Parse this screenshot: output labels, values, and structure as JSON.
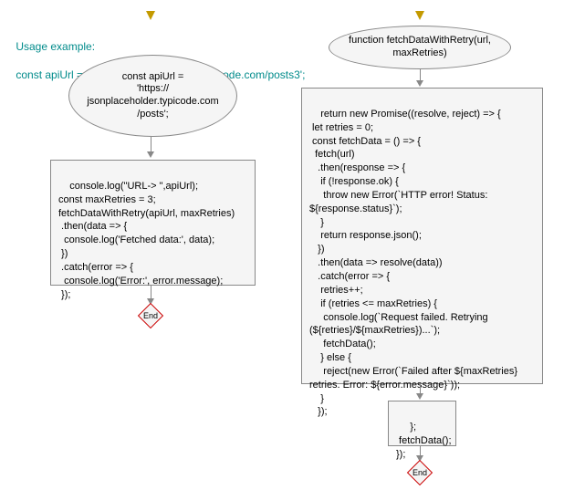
{
  "usage": {
    "line1": "Usage example:",
    "line2": "const apiUrl = 'https://jsonplaceholder.typicode.com/posts3';"
  },
  "left": {
    "ellipse_text": "const apiUrl =\n'https://\njsonplaceholder.typicode.com\n/posts';",
    "rect_text": "console.log(\"URL-> \",apiUrl);\nconst maxRetries = 3;\nfetchDataWithRetry(apiUrl, maxRetries)\n .then(data => {\n  console.log('Fetched data:', data);\n })\n .catch(error => {\n  console.log('Error:', error.message);\n });",
    "end_label": "End"
  },
  "right": {
    "ellipse_text": "function fetchDataWithRetry(url,\nmaxRetries)",
    "rect1_text": "return new Promise((resolve, reject) => {\n let retries = 0;\n const fetchData = () => {\n  fetch(url)\n   .then(response => {\n    if (!response.ok) {\n     throw new Error(`HTTP error! Status:\n${response.status}`);\n    }\n    return response.json();\n   })\n   .then(data => resolve(data))\n   .catch(error => {\n    retries++;\n    if (retries <= maxRetries) {\n     console.log(`Request failed. Retrying\n(${retries}/${maxRetries})...`);\n     fetchData();\n    } else {\n     reject(new Error(`Failed after ${maxRetries}\nretries. Error: ${error.message}`));\n    }\n   });",
    "rect2_text": " };\n fetchData();\n});",
    "end_label": "End"
  },
  "chart_data": {
    "type": "flowchart",
    "columns": [
      {
        "name": "left",
        "nodes": [
          {
            "id": "L-start",
            "type": "entry-arrow"
          },
          {
            "id": "L-ellipse",
            "type": "terminator-ellipse",
            "text": "const apiUrl = 'https://jsonplaceholder.typicode.com/posts';"
          },
          {
            "id": "L-rect",
            "type": "process",
            "text": "console.log(\"URL-> \",apiUrl); const maxRetries = 3; fetchDataWithRetry(apiUrl, maxRetries).then(data => { console.log('Fetched data:', data); }).catch(error => { console.log('Error:', error.message); });"
          },
          {
            "id": "L-end",
            "type": "end-diamond",
            "text": "End"
          }
        ],
        "edges": [
          {
            "from": "L-start",
            "to": "L-ellipse"
          },
          {
            "from": "L-ellipse",
            "to": "L-rect"
          },
          {
            "from": "L-rect",
            "to": "L-end"
          }
        ]
      },
      {
        "name": "right",
        "nodes": [
          {
            "id": "R-start",
            "type": "entry-arrow"
          },
          {
            "id": "R-ellipse",
            "type": "terminator-ellipse",
            "text": "function fetchDataWithRetry(url, maxRetries)"
          },
          {
            "id": "R-rect1",
            "type": "process",
            "text": "return new Promise((resolve, reject) => { let retries = 0; const fetchData = () => { fetch(url).then(response => { if (!response.ok) { throw new Error(`HTTP error! Status: ${response.status}`); } return response.json(); }).then(data => resolve(data)).catch(error => { retries++; if (retries <= maxRetries) { console.log(`Request failed. Retrying (${retries}/${maxRetries})...`); fetchData(); } else { reject(new Error(`Failed after ${maxRetries} retries. Error: ${error.message}`)); } });"
          },
          {
            "id": "R-rect2",
            "type": "process",
            "text": "}; fetchData(); });"
          },
          {
            "id": "R-end",
            "type": "end-diamond",
            "text": "End"
          }
        ],
        "edges": [
          {
            "from": "R-start",
            "to": "R-ellipse"
          },
          {
            "from": "R-ellipse",
            "to": "R-rect1"
          },
          {
            "from": "R-rect1",
            "to": "R-rect2"
          },
          {
            "from": "R-rect2",
            "to": "R-end"
          }
        ]
      }
    ]
  }
}
